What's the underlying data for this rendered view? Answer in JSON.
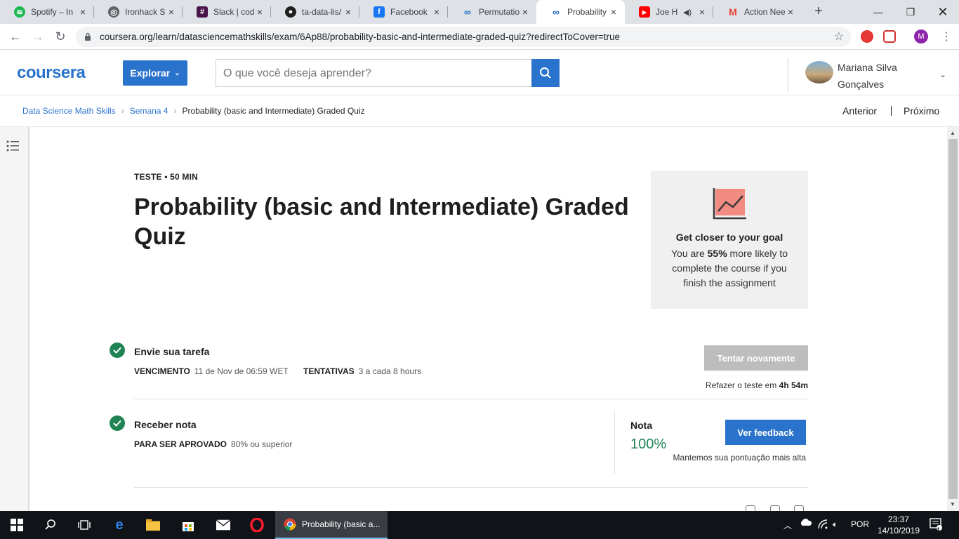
{
  "browser": {
    "tabs": [
      {
        "title": "Spotify – In",
        "icon": "spotify-icon",
        "color": "#1db954"
      },
      {
        "title": "Ironhack St",
        "icon": "globe-icon",
        "color": "#5f6368"
      },
      {
        "title": "Slack | code",
        "icon": "slack-icon",
        "color": "#4a154b"
      },
      {
        "title": "ta-data-lis/",
        "icon": "github-icon",
        "color": "#1f1f1f"
      },
      {
        "title": "Facebook",
        "icon": "facebook-icon",
        "color": "#1877f2"
      },
      {
        "title": "Permutation",
        "icon": "coursera-icon",
        "color": "#2a73cc"
      },
      {
        "title": "Probability",
        "icon": "coursera-icon",
        "color": "#2a73cc"
      },
      {
        "title": "Joe Hist",
        "icon": "youtube-icon",
        "color": "#ff0000"
      },
      {
        "title": "Action Nee",
        "icon": "gmail-icon",
        "color": "#ea4335"
      }
    ],
    "url": "coursera.org/learn/datasciencemathskills/exam/6Ap88/probability-basic-and-intermediate-graded-quiz?redirectToCover=true",
    "profile_initial": "M"
  },
  "header": {
    "logo": "coursera",
    "explore_label": "Explorar",
    "search_placeholder": "O que você deseja aprender?",
    "user_name": "Mariana Silva Gonçalves"
  },
  "breadcrumb": {
    "items": [
      "Data Science Math Skills",
      "Semana 4"
    ],
    "current": "Probability (basic and Intermediate) Graded Quiz",
    "prev_label": "Anterior",
    "next_label": "Próximo"
  },
  "quiz": {
    "meta": "TESTE • 50 MIN",
    "title": "Probability (basic and Intermediate) Graded Quiz"
  },
  "goal_card": {
    "heading": "Get closer to your goal",
    "text_before": "You are ",
    "percent": "55%",
    "text_after": " more likely to complete the course if you finish the assignment"
  },
  "submit": {
    "heading": "Envie sua tarefa",
    "due_label": "VENCIMENTO",
    "due_value": "11 de Nov de 06:59 WET",
    "attempts_label": "TENTATIVAS",
    "attempts_value": "3 a cada 8 hours",
    "retry_button": "Tentar novamente",
    "retry_note": "Refazer o teste em",
    "retry_time": "4h 54m"
  },
  "grade": {
    "heading": "Receber nota",
    "pass_label": "PARA SER APROVADO",
    "pass_value": "80% ou superior",
    "grade_label": "Nota",
    "grade_value": "100%",
    "feedback_button": "Ver feedback",
    "grade_note": "Mantemos sua pontuação mais alta"
  },
  "taskbar": {
    "active_app": "Probability (basic a...",
    "lang": "POR",
    "time": "23:37",
    "date": "14/10/2019",
    "notif_count": "1"
  },
  "colors": {
    "brand_blue": "#2a73cc",
    "success_green": "#1f8354",
    "disabled_gray": "#bdbdbd",
    "chart_pink": "#f28b82"
  }
}
